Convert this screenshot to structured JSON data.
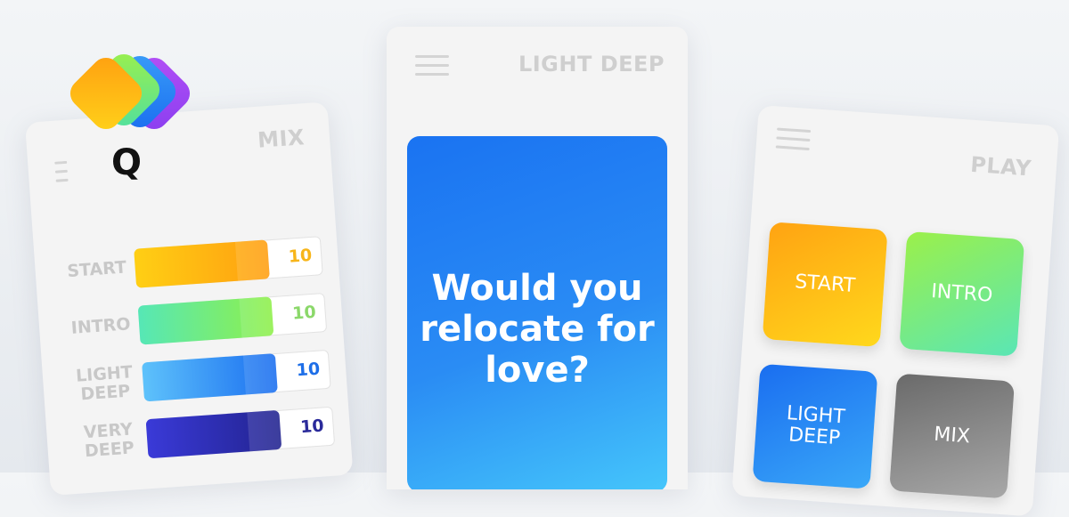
{
  "app": {
    "logo_letter": "Q"
  },
  "left_screen": {
    "title": "MIX",
    "levels": [
      {
        "label": "START",
        "value": "10",
        "fill_percent": 72,
        "color_from": "#ffcf14",
        "color_to": "#ff9f10",
        "value_color": "#f7b51a"
      },
      {
        "label": "INTRO",
        "value": "10",
        "fill_percent": 72,
        "color_from": "#56e7b6",
        "color_to": "#8ff04a",
        "value_color": "#8bd86a"
      },
      {
        "label": "LIGHT DEEP",
        "value": "10",
        "fill_percent": 72,
        "color_from": "#5ec2fb",
        "color_to": "#1a6ef0",
        "value_color": "#1d6ee8"
      },
      {
        "label": "VERY DEEP",
        "value": "10",
        "fill_percent": 72,
        "color_from": "#3a3ad8",
        "color_to": "#22238f",
        "value_color": "#2a2a9a"
      }
    ]
  },
  "center_screen": {
    "title": "LIGHT DEEP",
    "question": "Would you relocate for love?"
  },
  "right_screen": {
    "title": "PLAY",
    "tiles": [
      {
        "label": "START"
      },
      {
        "label": "INTRO"
      },
      {
        "label": "LIGHT DEEP"
      },
      {
        "label": "MIX"
      }
    ]
  },
  "colors": {
    "accent_blue": "#1a73f2",
    "start_orange": "#ffa312",
    "intro_green": "#7ff05a",
    "mix_gray": "#8a8a8a"
  }
}
